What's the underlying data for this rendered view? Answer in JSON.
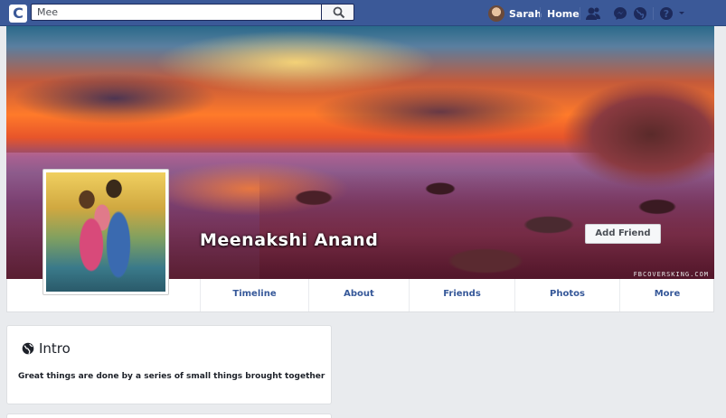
{
  "topbar": {
    "logo_letter": "C",
    "search_value": "Mee",
    "user_name": "Sarah",
    "home_label": "Home",
    "icons": [
      "friend-requests-icon",
      "messages-icon",
      "notifications-globe-icon",
      "help-icon",
      "account-caret-icon"
    ],
    "brand_color": "#3b5998"
  },
  "cover": {
    "name": "Meenakshi Anand",
    "add_friend_label": "Add Friend",
    "watermark": "FBCOVERSKING.COM"
  },
  "tabs": [
    "Timeline",
    "About",
    "Friends",
    "Photos",
    "More"
  ],
  "intro": {
    "title": "Intro",
    "bio": "Great things are done by a series of small things brought together"
  }
}
